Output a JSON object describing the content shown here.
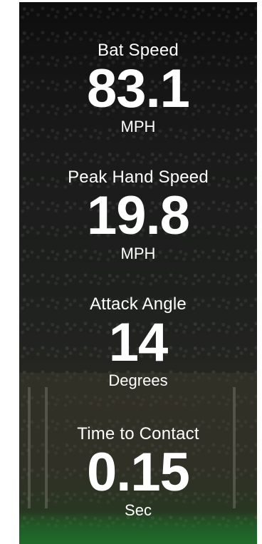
{
  "metrics": [
    {
      "label": "Bat Speed",
      "value": "83.1",
      "unit": "MPH"
    },
    {
      "label": "Peak Hand Speed",
      "value": "19.8",
      "unit": "MPH"
    },
    {
      "label": "Attack Angle",
      "value": "14",
      "unit": "Degrees"
    },
    {
      "label": "Time to Contact",
      "value": "0.15",
      "unit": "Sec"
    }
  ],
  "colors": {
    "text": "#ffffff",
    "background_dark": "#141414",
    "field_green": "#1f6a2a"
  }
}
